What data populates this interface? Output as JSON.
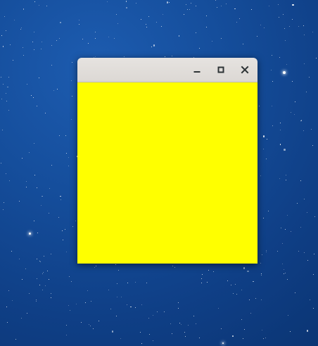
{
  "window": {
    "title": "",
    "content_color": "#ffff00",
    "titlebar_buttons": [
      {
        "name": "minimize",
        "icon": "minimize-icon"
      },
      {
        "name": "maximize",
        "icon": "maximize-icon"
      },
      {
        "name": "close",
        "icon": "close-icon"
      }
    ]
  },
  "desktop": {
    "wallpaper": "starry-blue-sky",
    "base_color": "#154e9c"
  }
}
